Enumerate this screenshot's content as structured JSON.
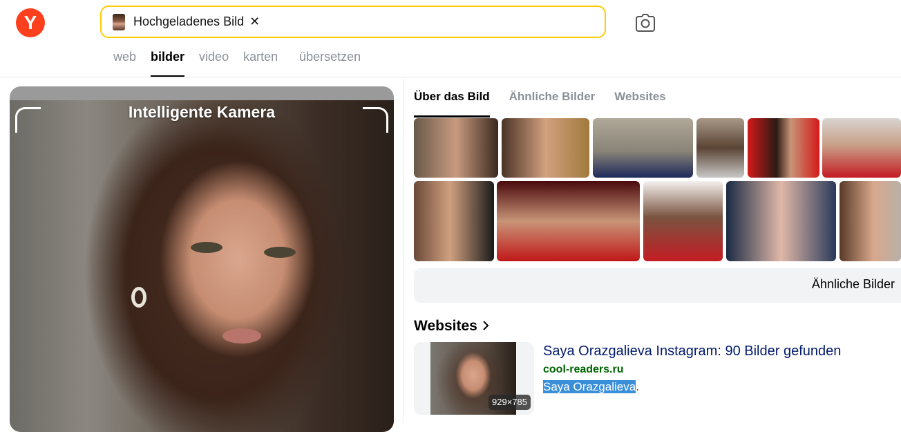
{
  "logo": {
    "letter": "Y"
  },
  "search": {
    "chip_label": "Hochgeladenes Bild",
    "close_glyph": "✕",
    "camera_icon": "camera-lens-icon"
  },
  "tabs": [
    {
      "label": "web",
      "active": false
    },
    {
      "label": "bilder",
      "active": true
    },
    {
      "label": "video",
      "active": false
    },
    {
      "label": "karten",
      "active": false
    },
    {
      "label": "übersetzen",
      "active": false
    }
  ],
  "left_panel": {
    "overlay_title": "Intelligente Kamera"
  },
  "right_panel": {
    "subtabs": [
      {
        "label": "Über das Bild",
        "active": true
      },
      {
        "label": "Ähnliche Bilder",
        "active": false
      },
      {
        "label": "Websites",
        "active": false
      }
    ],
    "similar_button_label": "Ähnliche Bilder",
    "websites_heading": "Websites",
    "result": {
      "title": "Saya Orazgalieva Instagram: 90 Bilder gefunden",
      "domain": "cool-readers.ru",
      "snippet_highlight": "Saya Orazgalieva",
      "snippet_rest": ".",
      "image_dimensions": "929×785"
    }
  },
  "colors": {
    "brand": "#fc3f1d",
    "search_border": "#ffcc00",
    "link": "#001a6b",
    "domain": "#006400",
    "highlight": "#3a8fd9"
  }
}
